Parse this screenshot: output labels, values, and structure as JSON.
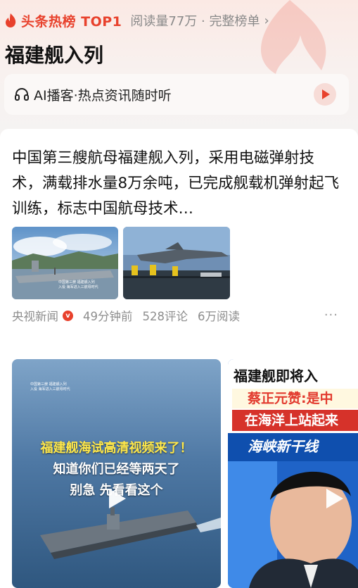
{
  "hot": {
    "label": "头条热榜 TOP1",
    "reads": "阅读量77万 · 完整榜单",
    "chevron": "›",
    "flame_icon": "flame-icon",
    "accent": "#e8412c"
  },
  "title": "福建舰入列",
  "podcast": {
    "icon": "headphones-icon",
    "text": "AI播客·热点资讯随时听"
  },
  "article": {
    "text": "中国第三艘航母福建舰入列，采用电磁弹射技术，满载排水量8万余吨，已完成舰载机弹射起飞训练，标志中国航母技术…",
    "thumb1_caption1": "中国第三艘 福建舰入列",
    "thumb1_caption2": "入役 海军进入三航母时代",
    "source": "央视新闻",
    "verified_mark": "v",
    "time": "49分钟前",
    "comments": "528评论",
    "reads": "6万阅读",
    "more": "···"
  },
  "videos": [
    {
      "line1": "福建舰海试高清视频来了！",
      "line2": "知道你们已经等两天了",
      "line3": "别急 先看看这个",
      "tiny_caption1": "中国第三艘 福建舰入列",
      "tiny_caption2": "入役 海军进入三航母时代"
    },
    {
      "title": "福建舰即将入",
      "banner1": "蔡正元赞:是中",
      "banner2": "在海洋上站起来",
      "logo": "海峡新干线"
    }
  ]
}
